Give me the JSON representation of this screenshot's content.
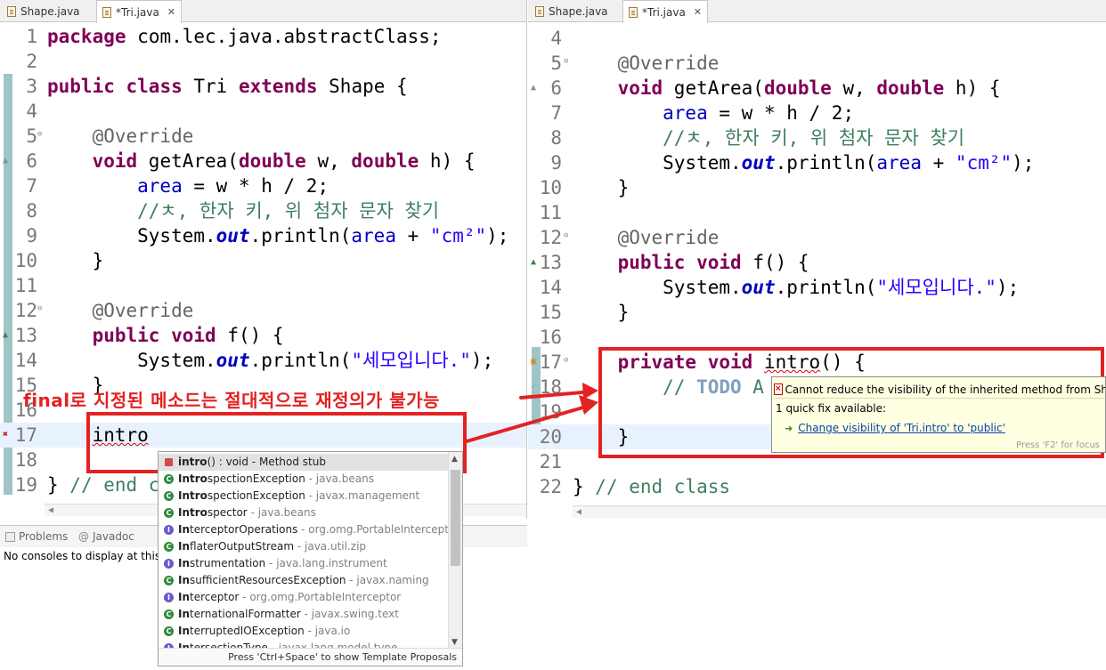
{
  "left_editor": {
    "tabs": [
      {
        "label": "Shape.java"
      },
      {
        "label": "*Tri.java",
        "close": "✕"
      }
    ],
    "lines": [
      {
        "n": "1",
        "segs": [
          [
            "kw",
            "package"
          ],
          [
            "",
            "com.lec.java.abstractClass;"
          ]
        ]
      },
      {
        "n": "2",
        "segs": []
      },
      {
        "n": "3",
        "segs": [
          [
            "kw",
            "public"
          ],
          [
            "",
            ""
          ],
          [
            "kw",
            "class"
          ],
          [
            "",
            "Tri"
          ],
          [
            "kw",
            "extends"
          ],
          [
            "",
            "Shape {"
          ]
        ]
      },
      {
        "n": "4",
        "segs": []
      },
      {
        "n": "5",
        "segs": [
          [
            "ann",
            "@Override"
          ]
        ]
      },
      {
        "n": "6",
        "segs": [
          [
            "kw",
            "void"
          ],
          [
            "",
            "getArea("
          ],
          [
            "kw",
            "double"
          ],
          [
            "",
            "w, "
          ],
          [
            "kw",
            "double"
          ],
          [
            "",
            "h) {"
          ]
        ]
      },
      {
        "n": "7",
        "segs": [
          [
            "fld",
            "area"
          ],
          [
            "",
            "= w * h / 2;"
          ]
        ]
      },
      {
        "n": "8",
        "segs": [
          [
            "cmt",
            "//ㅊ, 한자 키, 위 첨자 문자 찾기"
          ]
        ]
      },
      {
        "n": "9",
        "segs": [
          [
            "",
            "System."
          ],
          [
            "sfld",
            "out"
          ],
          [
            "",
            ".println("
          ],
          [
            "fld",
            "area"
          ],
          [
            "",
            "+ "
          ],
          [
            "str",
            "\"cm²\""
          ],
          [
            "",
            ");"
          ]
        ]
      },
      {
        "n": "10",
        "segs": [
          [
            "",
            "}"
          ]
        ]
      },
      {
        "n": "11",
        "segs": []
      },
      {
        "n": "12",
        "segs": [
          [
            "ann",
            "@Override"
          ]
        ]
      },
      {
        "n": "13",
        "segs": [
          [
            "kw",
            "public"
          ],
          [
            "kw",
            "void"
          ],
          [
            "",
            "f() {"
          ]
        ]
      },
      {
        "n": "14",
        "segs": [
          [
            "",
            "System."
          ],
          [
            "sfld",
            "out"
          ],
          [
            "",
            ".println("
          ],
          [
            "str",
            "\"세모입니다.\""
          ],
          [
            "",
            ");"
          ]
        ]
      },
      {
        "n": "15",
        "segs": [
          [
            "",
            "}"
          ]
        ]
      },
      {
        "n": "16",
        "segs": []
      },
      {
        "n": "17",
        "segs": [
          [
            "squig",
            "intro"
          ]
        ]
      },
      {
        "n": "18",
        "segs": []
      },
      {
        "n": "19",
        "segs": [
          [
            "",
            "} "
          ],
          [
            "cmt",
            "// end c"
          ]
        ]
      }
    ]
  },
  "right_editor": {
    "tabs": [
      {
        "label": "Shape.java"
      },
      {
        "label": "*Tri.java",
        "close": "✕"
      }
    ],
    "lines": [
      {
        "n": "4",
        "segs": []
      },
      {
        "n": "5",
        "segs": [
          [
            "ann",
            "@Override"
          ]
        ]
      },
      {
        "n": "6",
        "segs": [
          [
            "kw",
            "void"
          ],
          [
            "",
            "getArea("
          ],
          [
            "kw",
            "double"
          ],
          [
            "",
            "w, "
          ],
          [
            "kw",
            "double"
          ],
          [
            "",
            "h) {"
          ]
        ]
      },
      {
        "n": "7",
        "segs": [
          [
            "fld",
            "area"
          ],
          [
            "",
            "= w * h / 2;"
          ]
        ]
      },
      {
        "n": "8",
        "segs": [
          [
            "cmt",
            "//ㅊ, 한자 키, 위 첨자 문자 찾기"
          ]
        ]
      },
      {
        "n": "9",
        "segs": [
          [
            "",
            "System."
          ],
          [
            "sfld",
            "out"
          ],
          [
            "",
            ".println("
          ],
          [
            "fld",
            "area"
          ],
          [
            "",
            "+ "
          ],
          [
            "str",
            "\"cm²\""
          ],
          [
            "",
            ");"
          ]
        ]
      },
      {
        "n": "10",
        "segs": [
          [
            "",
            "}"
          ]
        ]
      },
      {
        "n": "11",
        "segs": []
      },
      {
        "n": "12",
        "segs": [
          [
            "ann",
            "@Override"
          ]
        ]
      },
      {
        "n": "13",
        "segs": [
          [
            "kw",
            "public"
          ],
          [
            "kw",
            "void"
          ],
          [
            "",
            "f() {"
          ]
        ]
      },
      {
        "n": "14",
        "segs": [
          [
            "",
            "System."
          ],
          [
            "sfld",
            "out"
          ],
          [
            "",
            ".println("
          ],
          [
            "str",
            "\"세모입니다.\""
          ],
          [
            "",
            ");"
          ]
        ]
      },
      {
        "n": "15",
        "segs": [
          [
            "",
            "}"
          ]
        ]
      },
      {
        "n": "16",
        "segs": []
      },
      {
        "n": "17",
        "segs": [
          [
            "kw",
            "private"
          ],
          [
            "kw",
            "void"
          ],
          [
            "squig",
            "intro"
          ],
          [
            "",
            "() {"
          ]
        ]
      },
      {
        "n": "18",
        "segs": [
          [
            "cmt",
            "// "
          ],
          [
            "todo",
            "TODO"
          ],
          [
            "cmt",
            " A"
          ]
        ]
      },
      {
        "n": "19",
        "segs": []
      },
      {
        "n": "20",
        "segs": [
          [
            "",
            "}"
          ]
        ]
      },
      {
        "n": "21",
        "segs": []
      },
      {
        "n": "22",
        "segs": [
          [
            "",
            "} "
          ],
          [
            "cmt",
            "// end class"
          ]
        ]
      }
    ]
  },
  "console": {
    "tabs": [
      {
        "label": "Problems"
      },
      {
        "label": "Javadoc"
      }
    ],
    "message": "No consoles to display at this tim"
  },
  "annotation": {
    "note": "final로 지정된 메소드는 절대적으로 재정의가 불가능",
    "color": "#e32222"
  },
  "content_assist": {
    "items": [
      {
        "bold": "intro",
        "rest": "() : void - Method stub",
        "pkg": "",
        "icon": "method"
      },
      {
        "bold": "Intro",
        "rest": "spectionException",
        "pkg": " - java.beans",
        "icon": "class"
      },
      {
        "bold": "Intro",
        "rest": "spectionException",
        "pkg": " - javax.management",
        "icon": "class"
      },
      {
        "bold": "Intro",
        "rest": "spector",
        "pkg": " - java.beans",
        "icon": "class"
      },
      {
        "bold": "In",
        "rest": "terceptorOperations",
        "pkg": " - org.omg.PortableInterceptor",
        "icon": "interface"
      },
      {
        "bold": "In",
        "rest": "flaterOutputStream",
        "pkg": " - java.util.zip",
        "icon": "class"
      },
      {
        "bold": "In",
        "rest": "strumentation",
        "pkg": " - java.lang.instrument",
        "icon": "interface"
      },
      {
        "bold": "In",
        "rest": "sufficientResourcesException",
        "pkg": " - javax.naming",
        "icon": "class"
      },
      {
        "bold": "In",
        "rest": "terceptor",
        "pkg": " - org.omg.PortableInterceptor",
        "icon": "interface"
      },
      {
        "bold": "In",
        "rest": "ternationalFormatter",
        "pkg": " - javax.swing.text",
        "icon": "class"
      },
      {
        "bold": "In",
        "rest": "terruptedIOException",
        "pkg": " - java.io",
        "icon": "class"
      },
      {
        "bold": "In",
        "rest": "tersectionType",
        "pkg": " - javax.lang.model.type",
        "icon": "interface"
      }
    ],
    "footer": "Press 'Ctrl+Space' to show Template Proposals"
  },
  "quick_fix": {
    "title": "Cannot reduce the visibility of the inherited method from Shape",
    "subtitle": "1 quick fix available:",
    "fix": "Change visibility of 'Tri.intro' to 'public'",
    "footer": "Press 'F2' for focus"
  }
}
